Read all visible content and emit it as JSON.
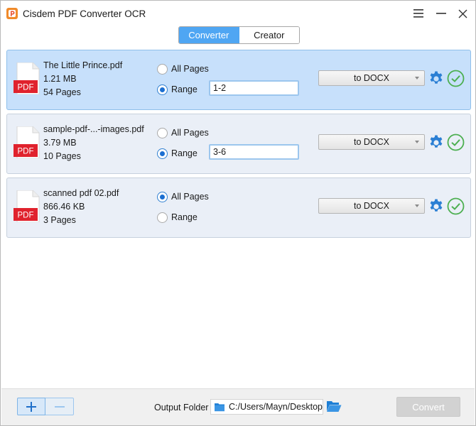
{
  "app": {
    "title": "Cisdem PDF Converter OCR",
    "icons": {
      "logo": "app-logo-icon",
      "menu": "hamburger-menu-icon",
      "minimize": "minimize-icon",
      "close": "close-icon"
    }
  },
  "tabs": [
    {
      "label": "Converter",
      "active": true
    },
    {
      "label": "Creator",
      "active": false
    }
  ],
  "files": [
    {
      "name": "The Little Prince.pdf",
      "size": "1.21 MB",
      "pages": "54 Pages",
      "icon_label": "PDF",
      "all_pages_label": "All Pages",
      "range_label": "Range",
      "range_selected": true,
      "range_value": "1-2",
      "format": "to DOCX",
      "selected": true
    },
    {
      "name": "sample-pdf-...-images.pdf",
      "size": "3.79 MB",
      "pages": "10 Pages",
      "icon_label": "PDF",
      "all_pages_label": "All Pages",
      "range_label": "Range",
      "range_selected": true,
      "range_value": "3-6",
      "format": "to DOCX",
      "selected": false
    },
    {
      "name": "scanned pdf 02.pdf",
      "size": "866.46 KB",
      "pages": "3 Pages",
      "icon_label": "PDF",
      "all_pages_label": "All Pages",
      "range_label": "Range",
      "range_selected": false,
      "range_value": "",
      "format": "to DOCX",
      "selected": false
    }
  ],
  "bottom": {
    "output_folder_label": "Output Folder",
    "output_path": "C:/Users/Mayn/Desktop",
    "convert_label": "Convert",
    "icons": {
      "add": "plus-icon",
      "remove": "minus-icon",
      "folder": "folder-icon",
      "browse": "open-folder-icon"
    }
  },
  "colors": {
    "accent": "#4fa6f3",
    "selected_row": "#c7e0fb",
    "row": "#eaeff7",
    "pdf_red": "#e0222d",
    "check_green": "#4caf50",
    "gear_blue": "#2b7fd4",
    "convert_disabled": "#d2d2d2"
  }
}
